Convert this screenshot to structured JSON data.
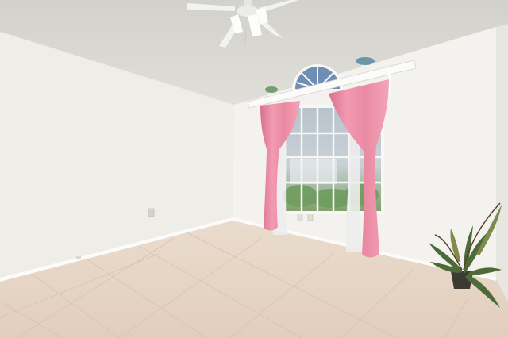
{
  "scene": {
    "colors": {
      "ceiling": "#d9d7d2",
      "wall_left": "#efede8",
      "wall_back": "#f3f2ee",
      "wall_right": "#ecebe6",
      "floor": "#e6d4c4",
      "grout": "#d3bfad",
      "baseboard": "#fbfbf9",
      "curtain": "#ee8fa8",
      "curtain_shade": "#d9708c",
      "sheer": "#eeeeee",
      "window_frame": "#f7f7f5",
      "window_glass": "#9fb0bd",
      "foliage": "#6f9c5f",
      "fan": "#f2f2f0",
      "plant": "#4e6a38"
    },
    "icons": [
      "ceiling-fan-icon",
      "potted-plant-icon",
      "outlet-icon",
      "flower-pot-icon"
    ]
  }
}
